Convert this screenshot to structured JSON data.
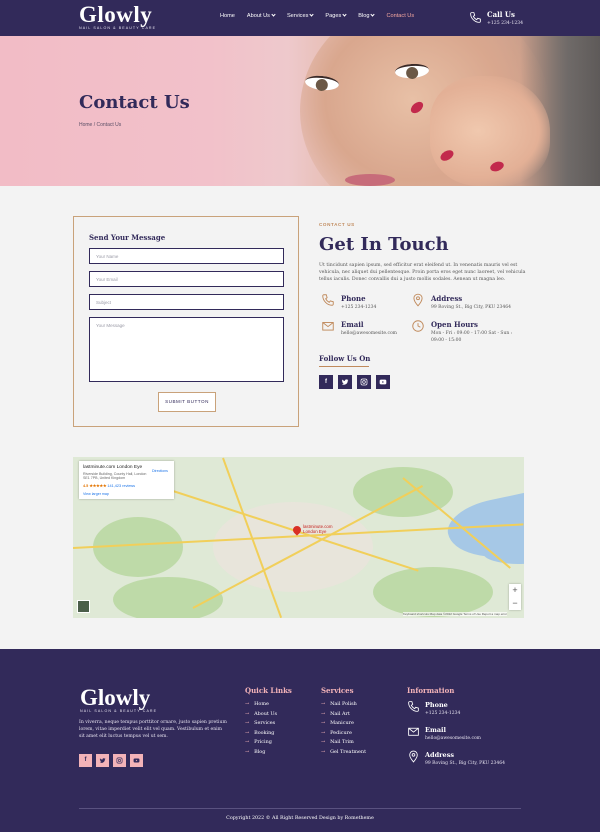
{
  "header": {
    "logo_word": "Glowly",
    "logo_tagline": "NAIL SALON & BEAUTY CARE",
    "nav": [
      {
        "label": "Home"
      },
      {
        "label": "About Us"
      },
      {
        "label": "Services"
      },
      {
        "label": "Pages"
      },
      {
        "label": "Blog"
      },
      {
        "label": "Contact Us"
      }
    ],
    "call_title": "Call Us",
    "call_number": "+125 234-1234"
  },
  "hero": {
    "title": "Contact Us",
    "breadcrumb": "Home / Contact Us"
  },
  "form": {
    "title": "Send Your Message",
    "name_placeholder": "Your Name",
    "email_placeholder": "Your Email",
    "subject_placeholder": "Subject",
    "message_placeholder": "Your Message",
    "submit_label": "SUBMIT BUTTON"
  },
  "contact": {
    "eyebrow": "CONTACT US",
    "title": "Get In Touch",
    "text": "Ut tincidunt sapien ipsum, sed efficitur erat eleifend ut. In venenatis mauris vel est vehicula, nec aliquet dui pellentesque. Proin porta eros eget nunc laoreet, vel vehicula tellus iaculis. Donec convallis dui a justo mollis sodales. Aenean ut magna leo.",
    "phone_title": "Phone",
    "phone_value": "+125 234-1234",
    "address_title": "Address",
    "address_value": "99 Roving St., Big City, PKU 23464",
    "email_title": "Email",
    "email_value": "hello@awesomesite.com",
    "hours_title": "Open Hours",
    "hours_line1": "Mon - Fri : 09:00 - 17:00 Sat - Sun :",
    "hours_line2": "09:00 - 15:00",
    "follow_title": "Follow Us On",
    "social": [
      "f",
      "t",
      "ig",
      "yt"
    ]
  },
  "map": {
    "place_name": "lastminute.com London Eye",
    "place_address": "Riverside Building, County Hall, London SE1 7PB, United Kingdom",
    "rating": "4.5 ★★★★★",
    "reviews": "141,423 reviews",
    "larger_map": "View larger map",
    "directions": "Directions",
    "pin_label_1": "lastminute.com",
    "pin_label_2": "London Eye",
    "zoom_in": "+",
    "zoom_out": "−",
    "footer_text": "Keyboard shortcuts  Map data ©2022 Google  Terms of Use  Report a map error"
  },
  "footer": {
    "logo_word": "Glowly",
    "logo_tagline": "NAIL SALON & BEAUTY CARE",
    "about": "In viverra, neque tempus porttitor ornare, justo sapien pretium lorem, vitae imperdiet velit elit vel quam. Vestibulum et enim sit amet elit luctus tempus vel ut sem.",
    "social": [
      "f",
      "t",
      "ig",
      "yt"
    ],
    "quick_links_title": "Quick Links",
    "quick_links": [
      "Home",
      "About Us",
      "Services",
      "Booking",
      "Pricing",
      "Blog"
    ],
    "services_title": "Services",
    "services": [
      "Nail Polish",
      "Nail Art",
      "Manicure",
      "Pedicure",
      "Nail Trim",
      "Gel Treatment"
    ],
    "info_title": "Information",
    "phone_title": "Phone",
    "phone_value": "+125 234-1234",
    "email_title": "Email",
    "email_value": "hello@awesomesite.com",
    "address_title": "Address",
    "address_value": "99 Roving St., Big City, PKU 23464",
    "copyright": "Copyright 2022 © All Right Reserved Design by Rometheme"
  },
  "colors": {
    "brand_dark": "#322a5a",
    "accent_pink": "#f3b3b8",
    "accent_gold": "#c08a5c"
  }
}
